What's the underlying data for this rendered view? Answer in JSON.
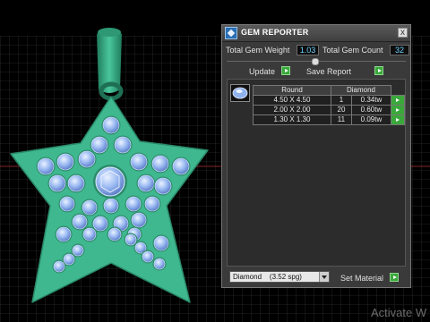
{
  "panel": {
    "title": "GEM REPORTER",
    "close_label": "x",
    "total_gem_weight_label": "Total Gem Weight",
    "total_gem_weight_value": "1.03",
    "total_gem_count_label": "Total Gem Count",
    "total_gem_count_value": "32",
    "update_label": "Update",
    "save_report_label": "Save Report",
    "table": {
      "headers": [
        "Round",
        "Diamond"
      ],
      "rows": [
        {
          "size": "4.50 X 4.50",
          "count": "1",
          "weight": "0.34tw"
        },
        {
          "size": "2.00 X 2.00",
          "count": "20",
          "weight": "0.60tw"
        },
        {
          "size": "1.30 X 1.30",
          "count": "11",
          "weight": "0.09tw"
        }
      ]
    },
    "material_select_value": "Diamond    (3.52 spg)",
    "set_material_label": "Set Material"
  },
  "watermark": "Activate W",
  "colors": {
    "pendant": "#3fb88f",
    "gem": "#8fb2ef",
    "grid": "#4a4a4a",
    "go_button": "#3aa83a"
  },
  "icons": [
    "gem-reporter-app-icon",
    "close-icon",
    "play-arrow-icon",
    "round-gem-icon",
    "dropdown-arrow-icon"
  ]
}
